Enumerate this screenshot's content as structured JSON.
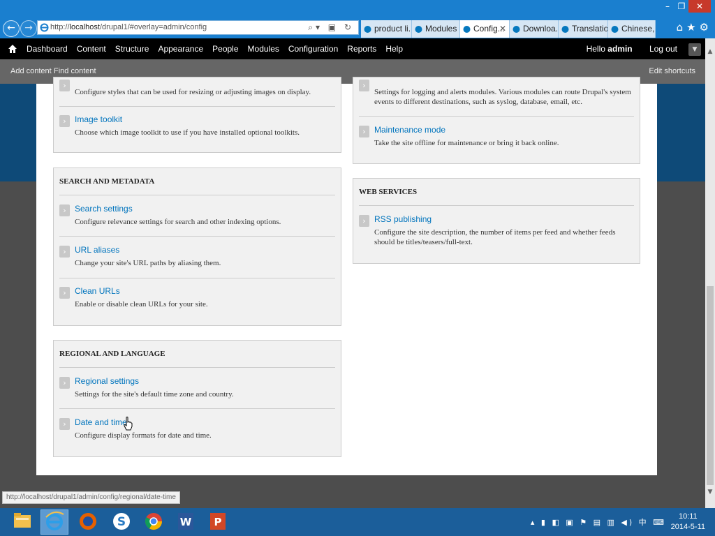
{
  "browser": {
    "url_prefix": "http://",
    "url_host": "localhost",
    "url_path": "/drupal1/#overlay=admin/config",
    "tabs": [
      {
        "label": "product li..."
      },
      {
        "label": "Modules ..."
      },
      {
        "label": "Config...",
        "active": true
      },
      {
        "label": "Downloa..."
      },
      {
        "label": "Translatio..."
      },
      {
        "label": "Chinese, ..."
      }
    ]
  },
  "toolbar": {
    "menu": [
      "Dashboard",
      "Content",
      "Structure",
      "Appearance",
      "People",
      "Modules",
      "Configuration",
      "Reports",
      "Help"
    ],
    "hello": "Hello ",
    "username": "admin",
    "logout": "Log out"
  },
  "shortcuts": {
    "add_content": "Add content",
    "find_content": "Find content",
    "edit_shortcuts": "Edit shortcuts"
  },
  "media_panel": {
    "image_styles_desc": "Configure styles that can be used for resizing or adjusting images on display.",
    "image_toolkit_title": "Image toolkit",
    "image_toolkit_desc": "Choose which image toolkit to use if you have installed optional toolkits."
  },
  "search_panel": {
    "heading": "Search and metadata",
    "items": [
      {
        "title": "Search settings",
        "desc": "Configure relevance settings for search and other indexing options."
      },
      {
        "title": "URL aliases",
        "desc": "Change your site's URL paths by aliasing them."
      },
      {
        "title": "Clean URLs",
        "desc": "Enable or disable clean URLs for your site."
      }
    ]
  },
  "regional_panel": {
    "heading": "Regional and language",
    "items": [
      {
        "title": "Regional settings",
        "desc": "Settings for the site's default time zone and country."
      },
      {
        "title": "Date and time",
        "desc": "Configure display formats for date and time."
      }
    ]
  },
  "development_panel": {
    "logging_desc": "Settings for logging and alerts modules. Various modules can route Drupal's system events to different destinations, such as syslog, database, email, etc.",
    "maintenance_title": "Maintenance mode",
    "maintenance_desc": "Take the site offline for maintenance or bring it back online."
  },
  "web_services_panel": {
    "heading": "Web services",
    "items": [
      {
        "title": "RSS publishing",
        "desc": "Configure the site description, the number of items per feed and whether feeds should be titles/teasers/full-text."
      }
    ]
  },
  "status_url": "http://localhost/drupal1/admin/config/regional/date-time",
  "taskbar": {
    "apps": [
      "file-explorer",
      "internet-explorer",
      "firefox",
      "skype",
      "chrome",
      "word",
      "powerpoint"
    ],
    "time": "10:11",
    "date": "2014-5-11"
  },
  "colors": {
    "link": "#0074bd",
    "toolbar_bg": "#000000",
    "shortcuts_bg": "#666666",
    "browser_chrome": "#1a7fcf",
    "taskbar": "#1b5e9a"
  }
}
